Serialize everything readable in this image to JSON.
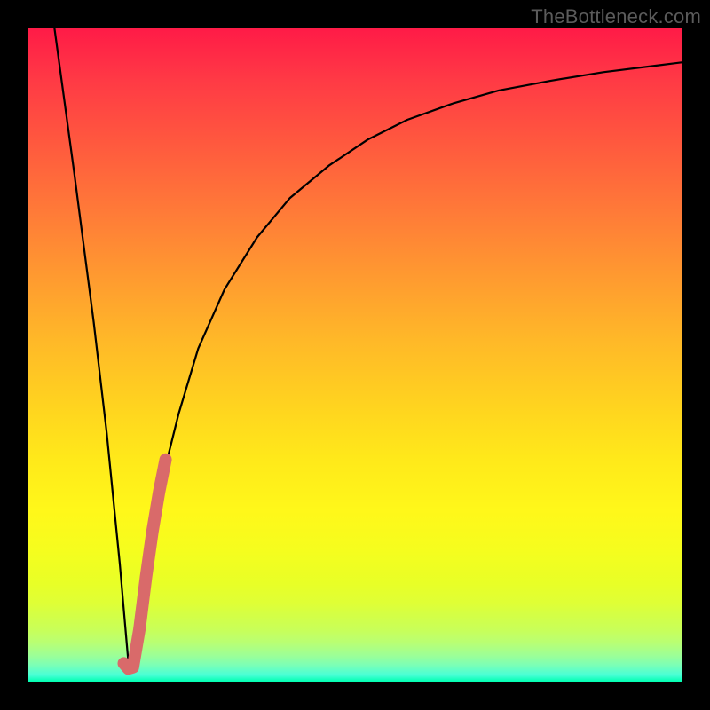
{
  "watermark": "TheBottleneck.com",
  "colors": {
    "frame": "#000000",
    "watermark": "#5b5b5b",
    "curve_black": "#000000",
    "curve_red": "#d96a6a"
  },
  "chart_data": {
    "type": "line",
    "title": "",
    "xlabel": "",
    "ylabel": "",
    "xlim": [
      0,
      100
    ],
    "ylim": [
      0,
      100
    ],
    "grid": false,
    "legend": false,
    "series": [
      {
        "name": "bottleneck-curve",
        "color": "#000000",
        "x": [
          4,
          7,
          10,
          12,
          14,
          15.3,
          16,
          17,
          18,
          20,
          23,
          26,
          30,
          35,
          40,
          46,
          52,
          58,
          65,
          72,
          80,
          88,
          96,
          100
        ],
        "y": [
          100,
          78,
          55,
          38,
          18,
          3,
          2,
          8,
          16,
          29,
          41,
          51,
          60,
          68,
          74,
          79,
          83,
          86,
          88.5,
          90.5,
          92,
          93.3,
          94.3,
          94.8
        ]
      },
      {
        "name": "highlight-J",
        "color": "#d96a6a",
        "x": [
          14.6,
          15.3,
          16.0,
          17.0,
          18.0,
          19.0,
          20.0,
          21.0
        ],
        "y": [
          2.8,
          2.0,
          2.2,
          8.0,
          16.0,
          23.0,
          29.0,
          34.0
        ]
      }
    ]
  }
}
